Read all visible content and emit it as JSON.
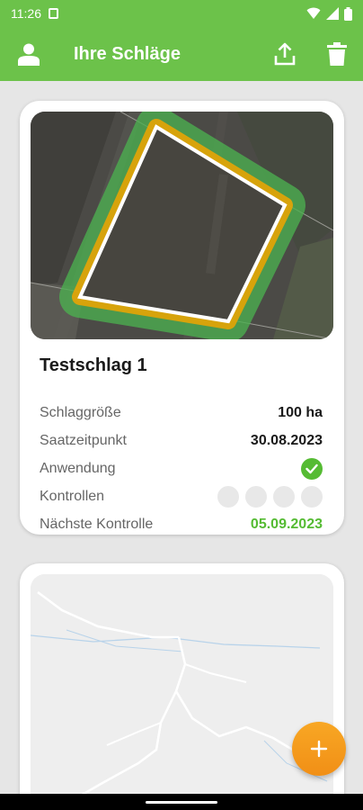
{
  "status_bar": {
    "time": "11:26",
    "icons": [
      "sim-card-icon",
      "wifi-icon",
      "signal-icon",
      "battery-icon"
    ]
  },
  "app_bar": {
    "title": "Ihre Schläge",
    "left_icon": "person-icon",
    "right_icons": [
      "upload-icon",
      "trash-icon"
    ],
    "color": "#6cc24a"
  },
  "fields": [
    {
      "name": "Testschlag 1",
      "rows": [
        {
          "label": "Schlaggröße",
          "value": "100 ha"
        },
        {
          "label": "Saatzeitpunkt",
          "value": "30.08.2023"
        },
        {
          "label": "Anwendung",
          "status": "done"
        },
        {
          "label": "Kontrollen",
          "controls_done": 0,
          "controls_total": 4
        },
        {
          "label": "Nächste Kontrolle",
          "value": "05.09.2023"
        }
      ]
    },
    {
      "name": ""
    }
  ],
  "fab": {
    "icon": "plus-icon",
    "color": "#f39a1a"
  },
  "colors": {
    "accent_green": "#55bb33",
    "buffer_green": "#4caf50",
    "buffer_orange": "#f0a500"
  }
}
